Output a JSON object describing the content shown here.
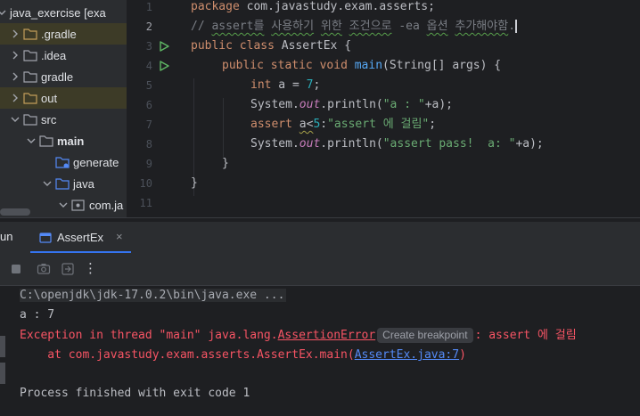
{
  "project_tree": {
    "items": [
      {
        "label": "java_exercise [exa",
        "expanded": true,
        "icon": "module-folder-icon"
      },
      {
        "label": ".gradle",
        "expanded": false,
        "icon": "folder-icon"
      },
      {
        "label": ".idea",
        "expanded": false,
        "icon": "folder-icon"
      },
      {
        "label": "gradle",
        "expanded": false,
        "icon": "folder-icon"
      },
      {
        "label": "out",
        "expanded": false,
        "icon": "folder-icon"
      },
      {
        "label": "src",
        "expanded": true,
        "icon": "folder-icon"
      },
      {
        "label": "main",
        "expanded": true,
        "icon": "folder-icon"
      },
      {
        "label": "generate",
        "expanded": false,
        "icon": "generated-folder-icon"
      },
      {
        "label": "java",
        "expanded": true,
        "icon": "source-folder-icon"
      },
      {
        "label": "com.ja",
        "expanded": true,
        "icon": "package-icon"
      }
    ]
  },
  "editor": {
    "line_numbers": [
      "1",
      "2",
      "3",
      "4",
      "5",
      "6",
      "7",
      "8",
      "9",
      "10",
      "11"
    ],
    "current_line": "2",
    "code": {
      "l1_kw": "package",
      "l1_rest": " com.javastudy.exam.asserts;",
      "l2_a": "// ",
      "l2_b": "assert를",
      "l2_c": " ",
      "l2_d": "사용하기",
      "l2_e": " ",
      "l2_f": "위한",
      "l2_g": " ",
      "l2_h": "조건으로",
      "l2_i": " -ea ",
      "l2_j": "옵션",
      "l2_k": " ",
      "l2_l": "추가해야함",
      "l2_m": ".",
      "l3_kw1": "public",
      "l3_kw2": "class",
      "l3_name": "AssertEx",
      "l3_brace": "{",
      "l4_kw1": "public",
      "l4_kw2": "static",
      "l4_kw3": "void",
      "l4_fn": "main",
      "l4_args": "(String[] args) {",
      "l5_kw": "int",
      "l5_var": " a = ",
      "l5_num": "7",
      "l5_end": ";",
      "l6_a": "System.",
      "l6_out": "out",
      "l6_b": ".println(",
      "l6_str": "\"a : \"",
      "l6_c": "+a);",
      "l7_kw": "assert",
      "l7_cond": "a<",
      "l7_num": "5",
      "l7_colon": ":",
      "l7_str": "\"assert 에 걸림\"",
      "l7_end": ";",
      "l8_a": "System.",
      "l8_out": "out",
      "l8_b": ".println(",
      "l8_str": "\"assert pass!  a: \"",
      "l8_c": "+a);",
      "l9": "}",
      "l10": "}"
    }
  },
  "run_panel": {
    "title": "un",
    "tab_label": "AssertEx",
    "tab_close": "×",
    "toolbar_more": "⋮"
  },
  "console": {
    "cmd": "C:\\openjdk\\jdk-17.0.2\\bin\\java.exe ...",
    "out1": "a : 7",
    "err_prefix": "Exception in thread \"main\" java.lang.",
    "err_class": "AssertionError",
    "badge": "Create breakpoint",
    "err_msg": ": assert 에 걸림",
    "at_prefix": "    at com.javastudy.exam.asserts.AssertEx.main(",
    "at_link": "AssertEx.java:7",
    "at_suffix": ")",
    "exit": "Process finished with exit code 1"
  },
  "colors": {
    "keyword": "#cf8e6d",
    "comment": "#7a7e85",
    "string": "#6aab73",
    "number": "#2aacb8",
    "function": "#56a8f5",
    "error": "#f75464",
    "link": "#548af7",
    "accent": "#3574f0",
    "run_green": "#5fb865"
  }
}
